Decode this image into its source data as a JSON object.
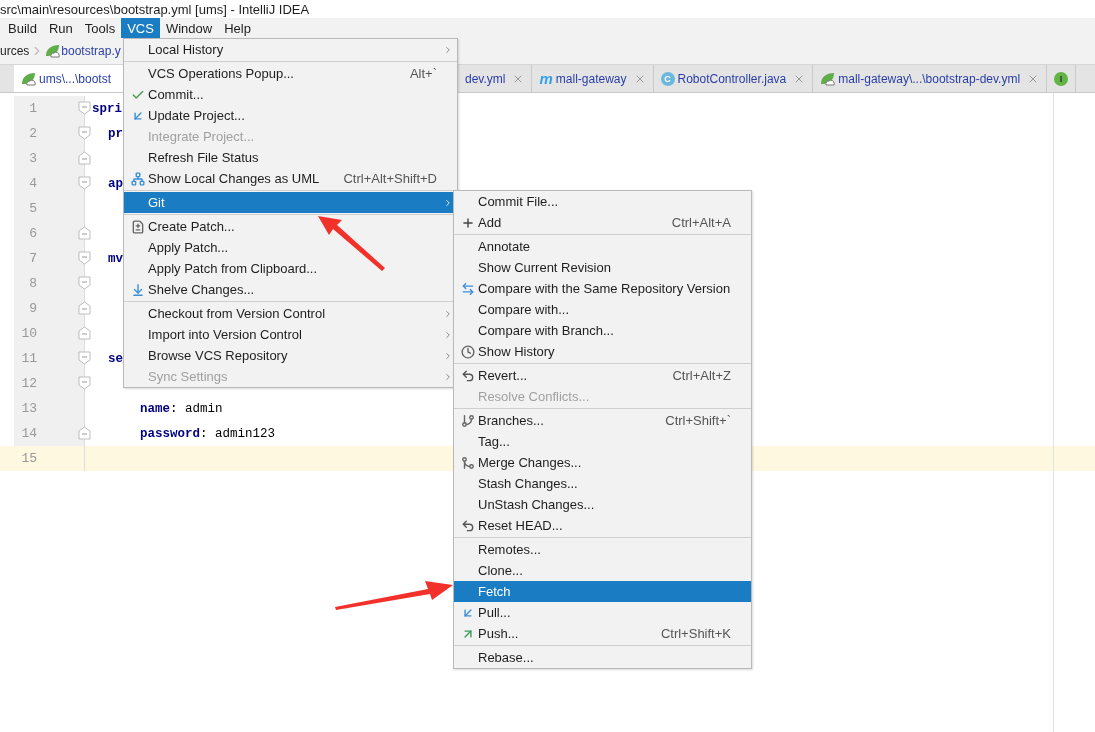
{
  "window": {
    "title": "src\\main\\resources\\bootstrap.yml [ums] - IntelliJ IDEA"
  },
  "menu_bar": [
    {
      "label": "Build",
      "selected": false
    },
    {
      "label": "Run",
      "selected": false
    },
    {
      "label": "Tools",
      "selected": false
    },
    {
      "label": "VCS",
      "selected": true
    },
    {
      "label": "Window",
      "selected": false
    },
    {
      "label": "Help",
      "selected": false
    }
  ],
  "breadcrumbs": [
    {
      "label": "urces",
      "kind": "folder"
    },
    {
      "label": "bootstrap.y",
      "kind": "yaml"
    }
  ],
  "tabs": [
    {
      "label": "ums\\...\\bootst",
      "kind": "yaml",
      "selected": true
    },
    {
      "label": "dev.yml",
      "kind": "plain",
      "selected": false
    },
    {
      "label": "mall-gateway",
      "kind": "maven",
      "icon_text": "m",
      "selected": false
    },
    {
      "label": "RobotController.java",
      "kind": "class",
      "icon_text": "C",
      "selected": false
    },
    {
      "label": "mall-gateway\\...\\bootstrap-dev.yml",
      "kind": "yaml",
      "selected": false
    },
    {
      "kind": "interface",
      "icon_text": "I",
      "selected": false
    }
  ],
  "editor": {
    "rows": [
      {
        "number": "1",
        "kind": "fold_start",
        "code": {
          "kind": "top_key",
          "text": "spri"
        },
        "current": false
      },
      {
        "number": "2",
        "kind": "fold_start",
        "code": {
          "kind": "key",
          "text": "pr"
        },
        "current": false
      },
      {
        "number": "3",
        "kind": "fold_end",
        "current": false
      },
      {
        "number": "4",
        "kind": "fold_start",
        "code": {
          "kind": "key",
          "text": "ap"
        },
        "current": false
      },
      {
        "number": "5",
        "kind": "plain",
        "current": false
      },
      {
        "number": "6",
        "kind": "fold_end",
        "current": false
      },
      {
        "number": "7",
        "kind": "fold_start",
        "code": {
          "kind": "key",
          "text": "mv"
        },
        "current": false
      },
      {
        "number": "8",
        "kind": "fold_start",
        "current": false
      },
      {
        "number": "9",
        "kind": "fold_end",
        "current": false
      },
      {
        "number": "10",
        "kind": "fold_end",
        "current": false
      },
      {
        "number": "11",
        "kind": "fold_start",
        "code": {
          "kind": "key",
          "text": "se"
        },
        "current": false
      },
      {
        "number": "12",
        "kind": "fold_start",
        "current": false
      },
      {
        "number": "13",
        "kind": "plain",
        "code": {
          "kind": "pair",
          "text": "**name**: admin"
        },
        "current": false
      },
      {
        "number": "14",
        "kind": "fold_end",
        "code": {
          "kind": "pair",
          "text": "**password**: admin123"
        },
        "current": false
      },
      {
        "number": "15",
        "kind": "plain",
        "current": true
      }
    ]
  },
  "vcs_menu": {
    "sections": [
      [
        {
          "label": "Local History",
          "kind": "plain",
          "submenu": true,
          "disabled": false,
          "selected": false
        }
      ],
      [
        {
          "label": "VCS Operations Popup...",
          "kind": "plain",
          "shortcut": "Alt+`",
          "submenu": false,
          "disabled": false,
          "selected": false
        },
        {
          "label": "Commit...",
          "kind": "check",
          "submenu": false,
          "disabled": false,
          "selected": false
        },
        {
          "label": "Update Project...",
          "kind": "update",
          "submenu": false,
          "disabled": false,
          "selected": false
        },
        {
          "label": "Integrate Project...",
          "kind": "plain",
          "submenu": false,
          "disabled": true,
          "selected": false
        },
        {
          "label": "Refresh File Status",
          "kind": "plain",
          "submenu": false,
          "disabled": false,
          "selected": false
        },
        {
          "label": "Show Local Changes as UML",
          "kind": "uml",
          "shortcut": "Ctrl+Alt+Shift+D",
          "submenu": false,
          "disabled": false,
          "selected": false
        }
      ],
      [
        {
          "label": "Git",
          "kind": "plain",
          "submenu": true,
          "disabled": false,
          "selected": true
        }
      ],
      [
        {
          "label": "Create Patch...",
          "kind": "patch",
          "submenu": false,
          "disabled": false,
          "selected": false
        },
        {
          "label": "Apply Patch...",
          "kind": "plain",
          "submenu": false,
          "disabled": false,
          "selected": false
        },
        {
          "label": "Apply Patch from Clipboard...",
          "kind": "plain",
          "submenu": false,
          "disabled": false,
          "selected": false
        },
        {
          "label": "Shelve Changes...",
          "kind": "shelve",
          "submenu": false,
          "disabled": false,
          "selected": false
        }
      ],
      [
        {
          "label": "Checkout from Version Control",
          "kind": "plain",
          "submenu": true,
          "disabled": false,
          "selected": false
        },
        {
          "label": "Import into Version Control",
          "kind": "plain",
          "submenu": true,
          "disabled": false,
          "selected": false
        },
        {
          "label": "Browse VCS Repository",
          "kind": "plain",
          "submenu": true,
          "disabled": false,
          "selected": false
        },
        {
          "label": "Sync Settings",
          "kind": "plain",
          "submenu": true,
          "disabled": true,
          "selected": false
        }
      ]
    ]
  },
  "git_menu": {
    "sections": [
      [
        {
          "label": "Commit File...",
          "kind": "plain",
          "submenu": false,
          "disabled": false,
          "selected": false
        },
        {
          "label": "Add",
          "kind": "add",
          "shortcut": "Ctrl+Alt+A",
          "submenu": false,
          "disabled": false,
          "selected": false
        }
      ],
      [
        {
          "label": "Annotate",
          "kind": "plain",
          "submenu": false,
          "disabled": false,
          "selected": false
        },
        {
          "label": "Show Current Revision",
          "kind": "plain",
          "submenu": false,
          "disabled": false,
          "selected": false
        },
        {
          "label": "Compare with the Same Repository Version",
          "kind": "compare",
          "submenu": false,
          "disabled": false,
          "selected": false
        },
        {
          "label": "Compare with...",
          "kind": "plain",
          "submenu": false,
          "disabled": false,
          "selected": false
        },
        {
          "label": "Compare with Branch...",
          "kind": "plain",
          "submenu": false,
          "disabled": false,
          "selected": false
        },
        {
          "label": "Show History",
          "kind": "history",
          "submenu": false,
          "disabled": false,
          "selected": false
        }
      ],
      [
        {
          "label": "Revert...",
          "kind": "revert",
          "shortcut": "Ctrl+Alt+Z",
          "submenu": false,
          "disabled": false,
          "selected": false
        },
        {
          "label": "Resolve Conflicts...",
          "kind": "plain",
          "submenu": false,
          "disabled": true,
          "selected": false
        }
      ],
      [
        {
          "label": "Branches...",
          "kind": "branch",
          "shortcut": "Ctrl+Shift+`",
          "submenu": false,
          "disabled": false,
          "selected": false
        },
        {
          "label": "Tag...",
          "kind": "plain",
          "submenu": false,
          "disabled": false,
          "selected": false
        },
        {
          "label": "Merge Changes...",
          "kind": "merge",
          "submenu": false,
          "disabled": false,
          "selected": false
        },
        {
          "label": "Stash Changes...",
          "kind": "plain",
          "submenu": false,
          "disabled": false,
          "selected": false
        },
        {
          "label": "UnStash Changes...",
          "kind": "plain",
          "submenu": false,
          "disabled": false,
          "selected": false
        },
        {
          "label": "Reset HEAD...",
          "kind": "revert",
          "submenu": false,
          "disabled": false,
          "selected": false
        }
      ],
      [
        {
          "label": "Remotes...",
          "kind": "plain",
          "submenu": false,
          "disabled": false,
          "selected": false
        },
        {
          "label": "Clone...",
          "kind": "plain",
          "submenu": false,
          "disabled": false,
          "selected": false
        },
        {
          "label": "Fetch",
          "kind": "plain",
          "submenu": false,
          "disabled": false,
          "selected": true
        },
        {
          "label": "Pull...",
          "kind": "pull",
          "submenu": false,
          "disabled": false,
          "selected": false
        },
        {
          "label": "Push...",
          "kind": "push",
          "shortcut": "Ctrl+Shift+K",
          "submenu": false,
          "disabled": false,
          "selected": false
        }
      ],
      [
        {
          "label": "Rebase...",
          "kind": "plain",
          "submenu": false,
          "disabled": false,
          "selected": false
        }
      ]
    ]
  }
}
